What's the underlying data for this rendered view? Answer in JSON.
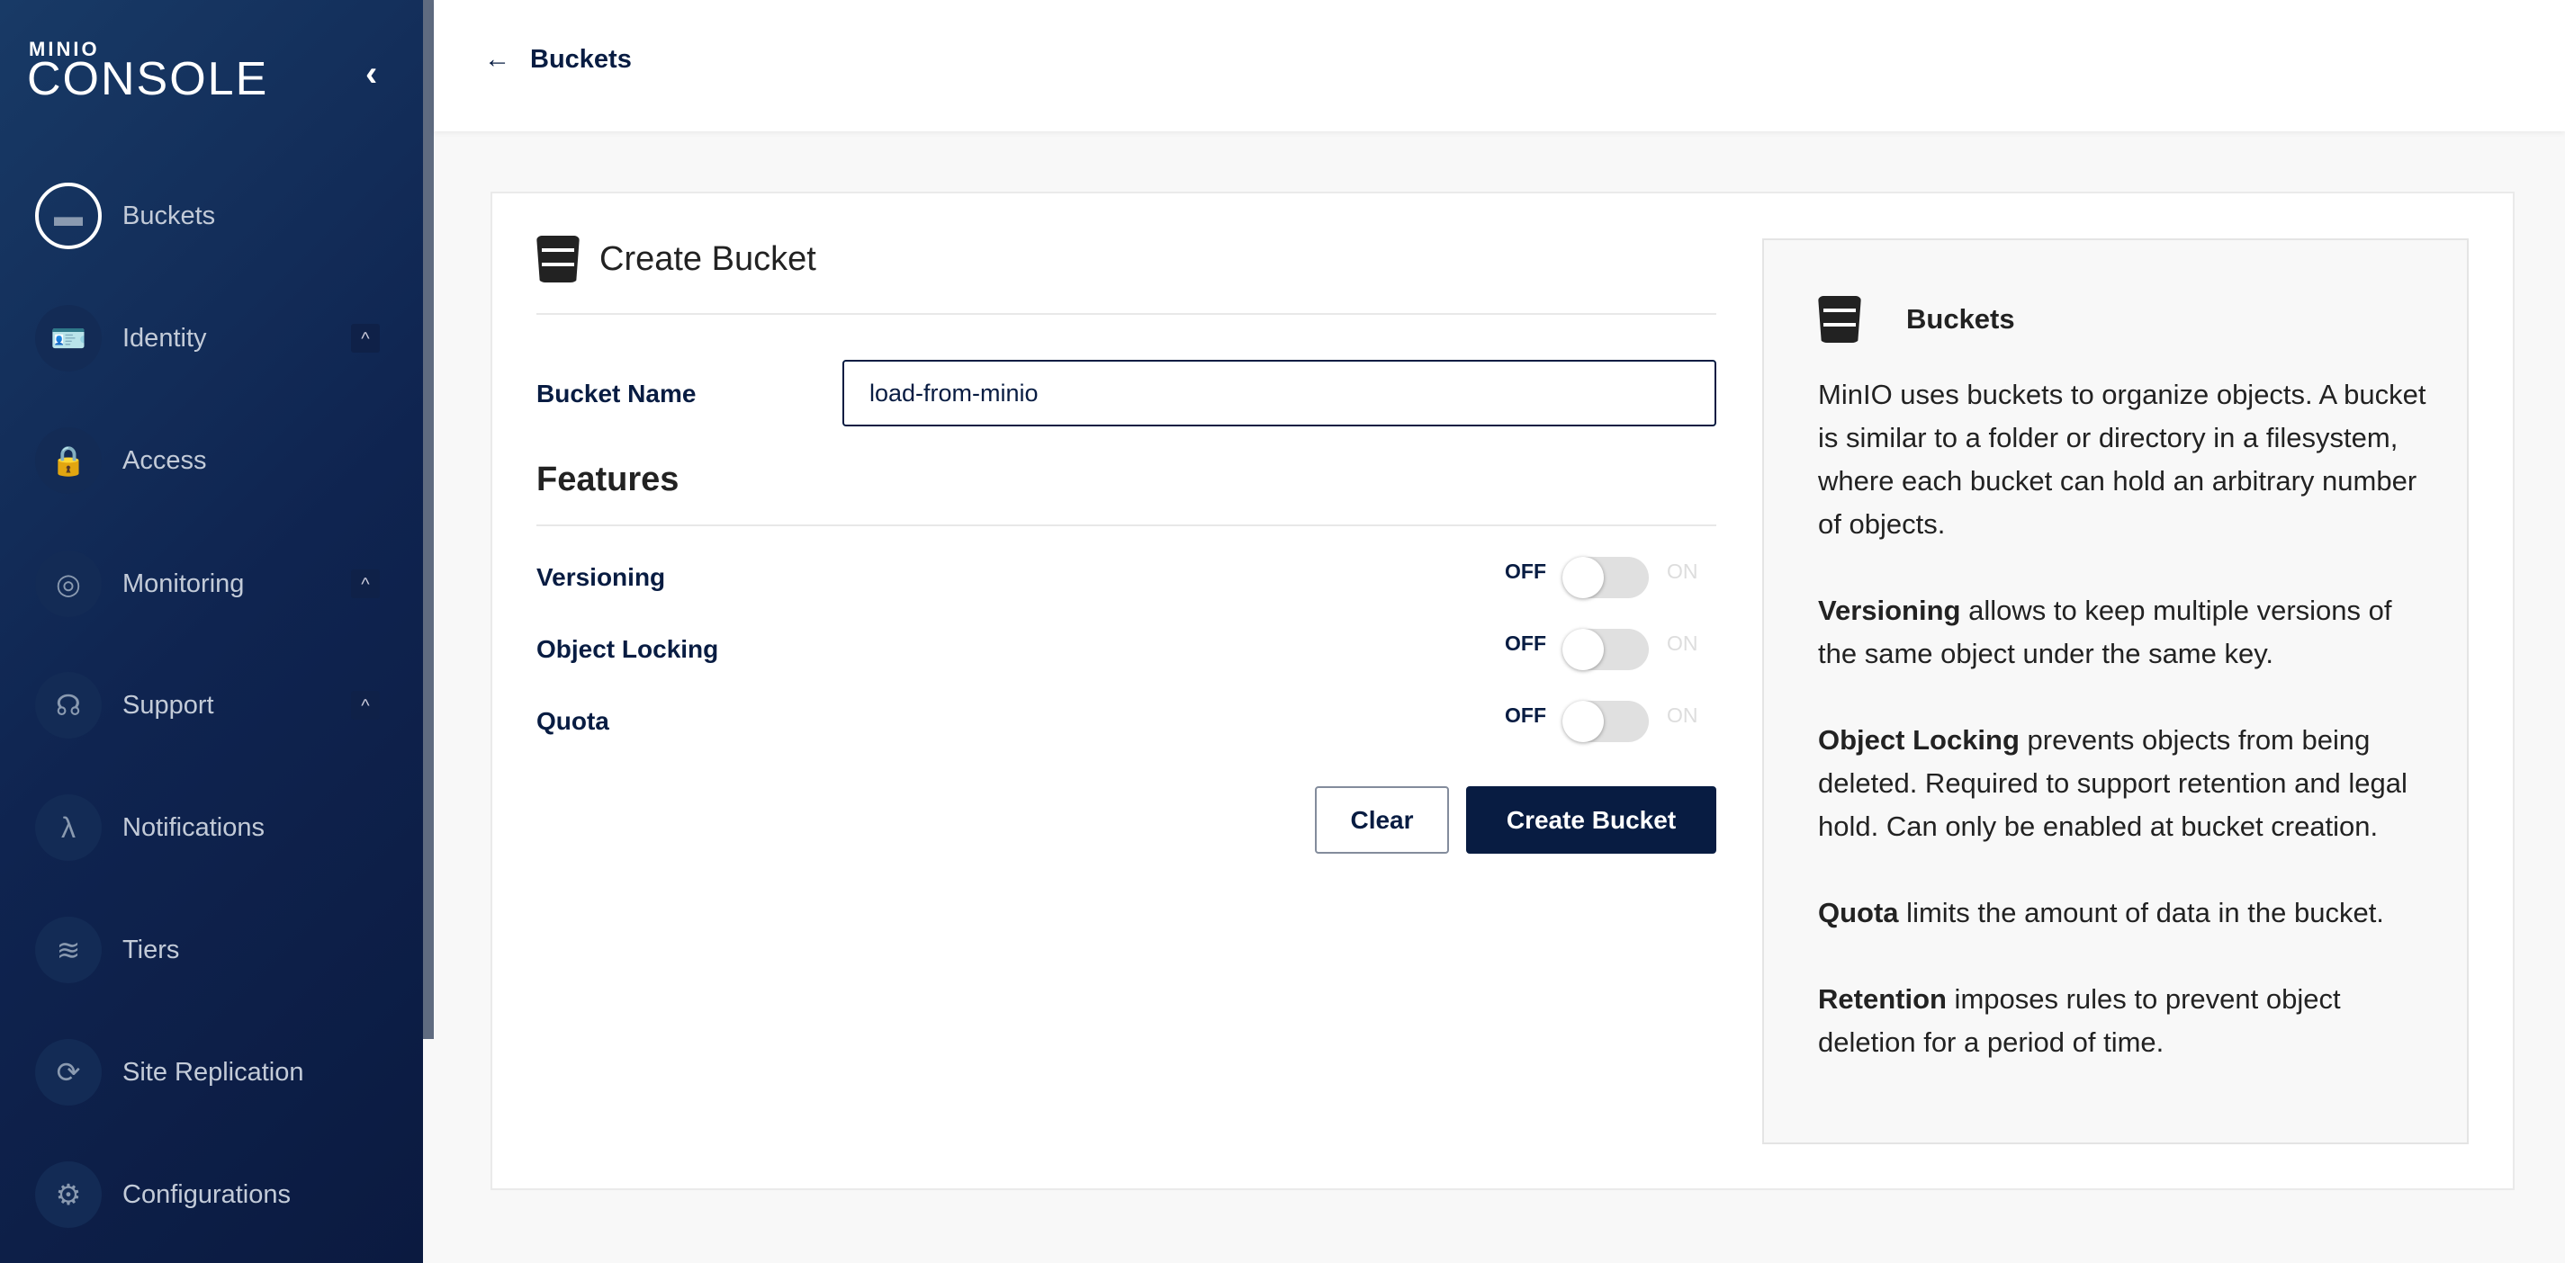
{
  "sidebar": {
    "logo_top": "MINIO",
    "logo_bottom": "CONSOLE",
    "items": [
      {
        "label": "Buckets",
        "icon": "bucket-icon",
        "active": true
      },
      {
        "label": "Identity",
        "icon": "id-card-icon",
        "expandable": true
      },
      {
        "label": "Access",
        "icon": "lock-shield-icon"
      },
      {
        "label": "Monitoring",
        "icon": "monitoring-icon",
        "expandable": true
      },
      {
        "label": "Support",
        "icon": "support-icon",
        "expandable": true
      },
      {
        "label": "Notifications",
        "icon": "lambda-icon"
      },
      {
        "label": "Tiers",
        "icon": "layers-icon"
      },
      {
        "label": "Site Replication",
        "icon": "replication-icon"
      },
      {
        "label": "Configurations",
        "icon": "gear-icon"
      }
    ]
  },
  "header": {
    "back_label": "Buckets"
  },
  "form": {
    "title": "Create Bucket",
    "bucket_name_label": "Bucket Name",
    "bucket_name_value": "load-from-minio",
    "features_title": "Features",
    "features": [
      {
        "label": "Versioning",
        "off": "OFF",
        "on": "ON",
        "enabled": false
      },
      {
        "label": "Object Locking",
        "off": "OFF",
        "on": "ON",
        "enabled": false
      },
      {
        "label": "Quota",
        "off": "OFF",
        "on": "ON",
        "enabled": false
      }
    ],
    "clear_label": "Clear",
    "create_label": "Create Bucket"
  },
  "info": {
    "title": "Buckets",
    "intro": "MinIO uses buckets to organize objects. A bucket is similar to a folder or directory in a filesystem, where each bucket can hold an arbitrary number of objects.",
    "items": [
      {
        "term": "Versioning",
        "text": " allows to keep multiple versions of the same object under the same key."
      },
      {
        "term": "Object Locking",
        "text": " prevents objects from being deleted. Required to support retention and legal hold. Can only be enabled at bucket creation."
      },
      {
        "term": "Quota",
        "text": " limits the amount of data in the bucket."
      },
      {
        "term": "Retention",
        "text": " imposes rules to prevent object deletion for a period of time."
      }
    ]
  },
  "colors": {
    "primary": "#081c42",
    "sidebar": "#0f2450"
  }
}
